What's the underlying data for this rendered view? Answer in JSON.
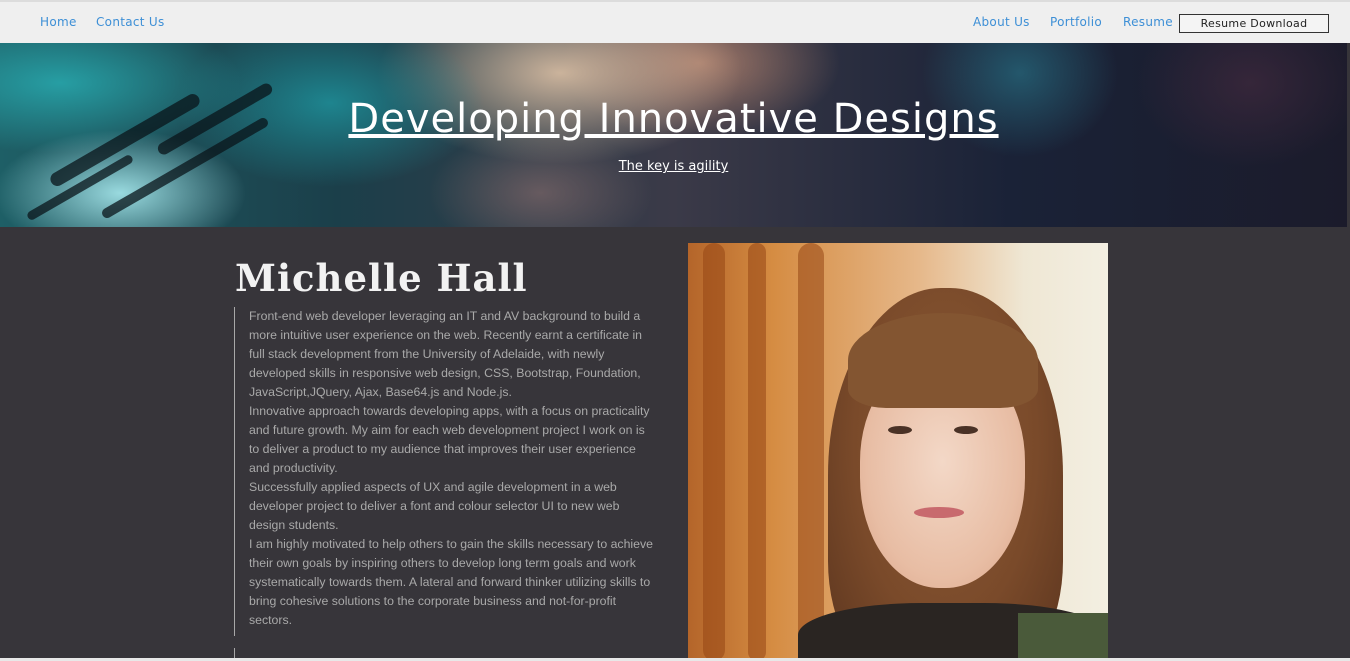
{
  "nav": {
    "home": "Home",
    "contact": "Contact Us",
    "about": "About Us",
    "portfolio": "Portfolio",
    "resume": "Resume",
    "resume_download": "Resume Download"
  },
  "hero": {
    "title": "Developing Innovative Designs",
    "subtitle": "The key is agility"
  },
  "profile": {
    "name": "Michelle Hall",
    "bio": "Front-end web developer leveraging an IT and AV background to build a more intuitive user experience on the web. Recently earnt a certificate in full stack development from the University of Adelaide, with newly developed skills in responsive web design, CSS, Bootstrap, Foundation, JavaScript,JQuery, Ajax, Base64.js and Node.js.",
    "bio2": "Innovative approach towards developing apps, with a focus on practicality and future growth. My aim for each web development project I work on is to deliver a product to my audience that improves their user experience and productivity.",
    "bio3": "Successfully applied aspects of UX and agile development in a web developer project to deliver a font and colour selector UI to new web design students.",
    "bio4": "I am highly motivated to help others to gain the skills necessary to achieve their own goals by inspiring others to develop long term goals and work systematically towards them. A lateral and forward thinker utilizing skills to bring cohesive solutions to the corporate business and not-for-profit sectors."
  },
  "colors": {
    "nav_bg": "#efefef",
    "nav_link": "#3d8fd6",
    "page_bg": "#37353a",
    "bio_text": "#a9a9a9"
  }
}
